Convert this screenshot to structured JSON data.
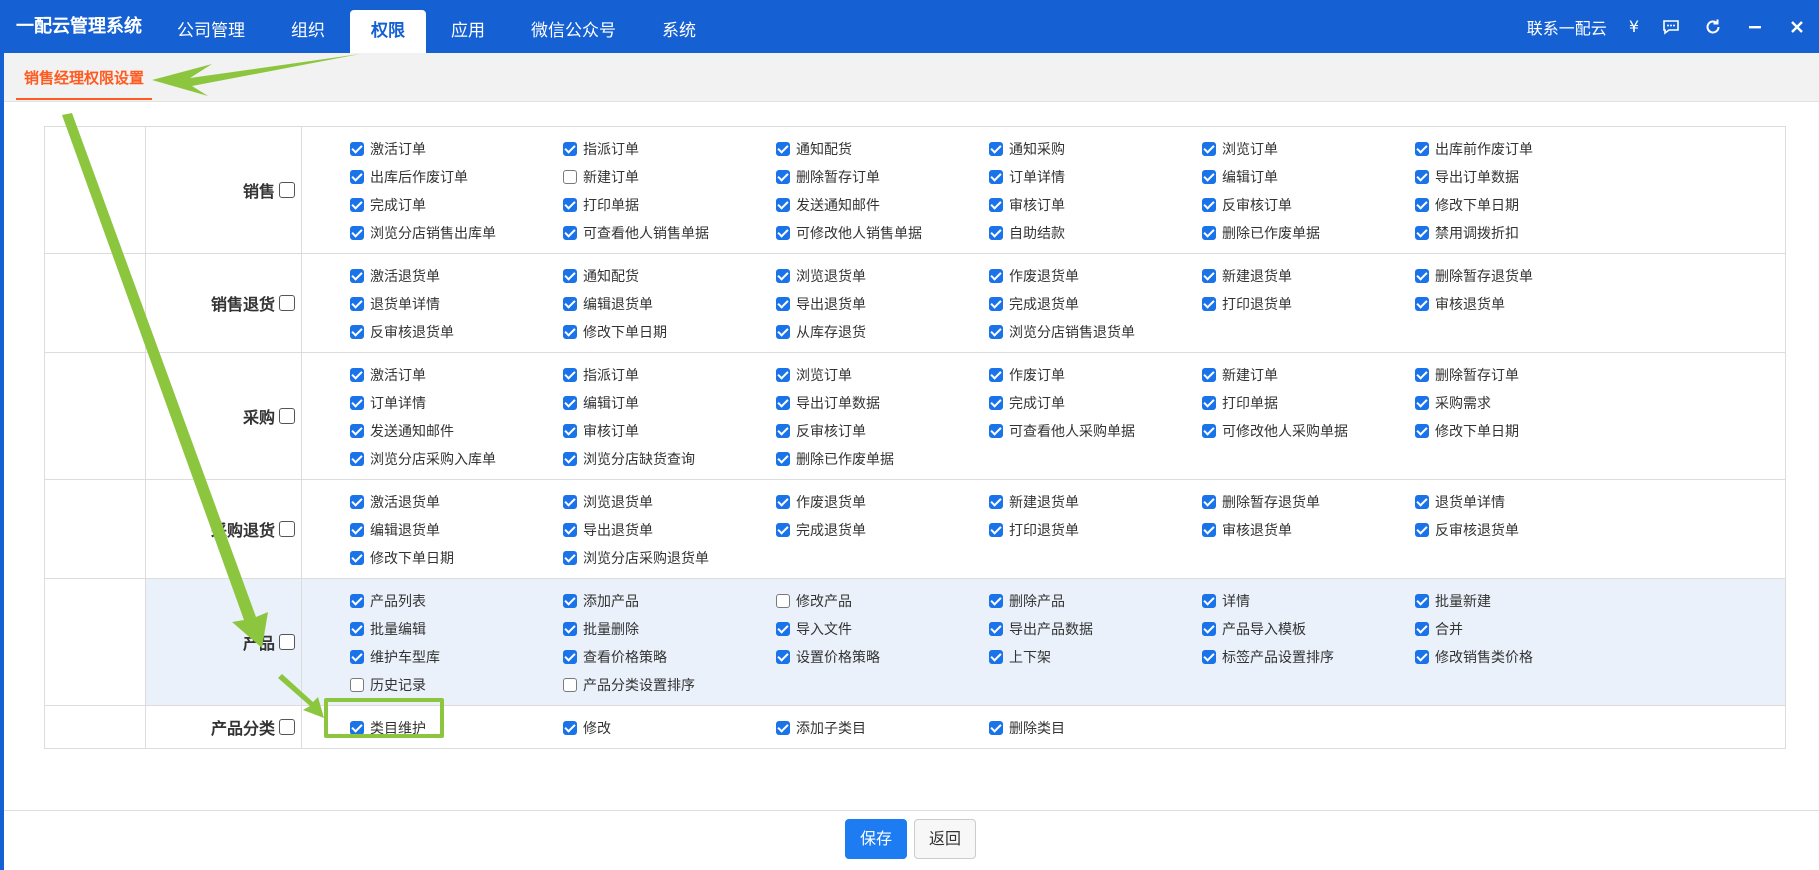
{
  "app": {
    "title": "一配云管理系统"
  },
  "nav": {
    "items": [
      {
        "label": "公司管理",
        "active": false
      },
      {
        "label": "组织",
        "active": false
      },
      {
        "label": "权限",
        "active": true
      },
      {
        "label": "应用",
        "active": false
      },
      {
        "label": "微信公众号",
        "active": false
      },
      {
        "label": "系统",
        "active": false
      }
    ]
  },
  "header_right": {
    "contact": "联系一配云",
    "currency_symbol": "¥"
  },
  "tab": {
    "active_label": "销售经理权限设置"
  },
  "groups": [
    {
      "name": "销售",
      "checked": false,
      "highlight": false,
      "items": [
        {
          "label": "激活订单",
          "checked": true
        },
        {
          "label": "指派订单",
          "checked": true
        },
        {
          "label": "通知配货",
          "checked": true
        },
        {
          "label": "通知采购",
          "checked": true
        },
        {
          "label": "浏览订单",
          "checked": true
        },
        {
          "label": "出库前作废订单",
          "checked": true
        },
        {
          "label": "出库后作废订单",
          "checked": true
        },
        {
          "label": "新建订单",
          "checked": false
        },
        {
          "label": "删除暂存订单",
          "checked": true
        },
        {
          "label": "订单详情",
          "checked": true
        },
        {
          "label": "编辑订单",
          "checked": true
        },
        {
          "label": "导出订单数据",
          "checked": true
        },
        {
          "label": "完成订单",
          "checked": true
        },
        {
          "label": "打印单据",
          "checked": true
        },
        {
          "label": "发送通知邮件",
          "checked": true
        },
        {
          "label": "审核订单",
          "checked": true
        },
        {
          "label": "反审核订单",
          "checked": true
        },
        {
          "label": "修改下单日期",
          "checked": true
        },
        {
          "label": "浏览分店销售出库单",
          "checked": true
        },
        {
          "label": "可查看他人销售单据",
          "checked": true
        },
        {
          "label": "可修改他人销售单据",
          "checked": true
        },
        {
          "label": "自助结款",
          "checked": true
        },
        {
          "label": "删除已作废单据",
          "checked": true
        },
        {
          "label": "禁用调拨折扣",
          "checked": true
        }
      ]
    },
    {
      "name": "销售退货",
      "checked": false,
      "highlight": false,
      "items": [
        {
          "label": "激活退货单",
          "checked": true
        },
        {
          "label": "通知配货",
          "checked": true
        },
        {
          "label": "浏览退货单",
          "checked": true
        },
        {
          "label": "作废退货单",
          "checked": true
        },
        {
          "label": "新建退货单",
          "checked": true
        },
        {
          "label": "删除暂存退货单",
          "checked": true
        },
        {
          "label": "退货单详情",
          "checked": true
        },
        {
          "label": "编辑退货单",
          "checked": true
        },
        {
          "label": "导出退货单",
          "checked": true
        },
        {
          "label": "完成退货单",
          "checked": true
        },
        {
          "label": "打印退货单",
          "checked": true
        },
        {
          "label": "审核退货单",
          "checked": true
        },
        {
          "label": "反审核退货单",
          "checked": true
        },
        {
          "label": "修改下单日期",
          "checked": true
        },
        {
          "label": "从库存退货",
          "checked": true
        },
        {
          "label": "浏览分店销售退货单",
          "checked": true
        }
      ]
    },
    {
      "name": "采购",
      "checked": false,
      "highlight": false,
      "items": [
        {
          "label": "激活订单",
          "checked": true
        },
        {
          "label": "指派订单",
          "checked": true
        },
        {
          "label": "浏览订单",
          "checked": true
        },
        {
          "label": "作废订单",
          "checked": true
        },
        {
          "label": "新建订单",
          "checked": true
        },
        {
          "label": "删除暂存订单",
          "checked": true
        },
        {
          "label": "订单详情",
          "checked": true
        },
        {
          "label": "编辑订单",
          "checked": true
        },
        {
          "label": "导出订单数据",
          "checked": true
        },
        {
          "label": "完成订单",
          "checked": true
        },
        {
          "label": "打印单据",
          "checked": true
        },
        {
          "label": "采购需求",
          "checked": true
        },
        {
          "label": "发送通知邮件",
          "checked": true
        },
        {
          "label": "审核订单",
          "checked": true
        },
        {
          "label": "反审核订单",
          "checked": true
        },
        {
          "label": "可查看他人采购单据",
          "checked": true
        },
        {
          "label": "可修改他人采购单据",
          "checked": true
        },
        {
          "label": "修改下单日期",
          "checked": true
        },
        {
          "label": "浏览分店采购入库单",
          "checked": true
        },
        {
          "label": "浏览分店缺货查询",
          "checked": true
        },
        {
          "label": "删除已作废单据",
          "checked": true
        }
      ]
    },
    {
      "name": "采购退货",
      "checked": false,
      "highlight": false,
      "items": [
        {
          "label": "激活退货单",
          "checked": true
        },
        {
          "label": "浏览退货单",
          "checked": true
        },
        {
          "label": "作废退货单",
          "checked": true
        },
        {
          "label": "新建退货单",
          "checked": true
        },
        {
          "label": "删除暂存退货单",
          "checked": true
        },
        {
          "label": "退货单详情",
          "checked": true
        },
        {
          "label": "编辑退货单",
          "checked": true
        },
        {
          "label": "导出退货单",
          "checked": true
        },
        {
          "label": "完成退货单",
          "checked": true
        },
        {
          "label": "打印退货单",
          "checked": true
        },
        {
          "label": "审核退货单",
          "checked": true
        },
        {
          "label": "反审核退货单",
          "checked": true
        },
        {
          "label": "修改下单日期",
          "checked": true
        },
        {
          "label": "浏览分店采购退货单",
          "checked": true
        }
      ]
    },
    {
      "name": "产品",
      "checked": false,
      "highlight": true,
      "items": [
        {
          "label": "产品列表",
          "checked": true
        },
        {
          "label": "添加产品",
          "checked": true
        },
        {
          "label": "修改产品",
          "checked": false
        },
        {
          "label": "删除产品",
          "checked": true
        },
        {
          "label": "详情",
          "checked": true
        },
        {
          "label": "批量新建",
          "checked": true
        },
        {
          "label": "批量编辑",
          "checked": true
        },
        {
          "label": "批量删除",
          "checked": true
        },
        {
          "label": "导入文件",
          "checked": true
        },
        {
          "label": "导出产品数据",
          "checked": true
        },
        {
          "label": "产品导入模板",
          "checked": true
        },
        {
          "label": "合并",
          "checked": true
        },
        {
          "label": "维护车型库",
          "checked": true
        },
        {
          "label": "查看价格策略",
          "checked": true
        },
        {
          "label": "设置价格策略",
          "checked": true
        },
        {
          "label": "上下架",
          "checked": true
        },
        {
          "label": "标签产品设置排序",
          "checked": true
        },
        {
          "label": "修改销售类价格",
          "checked": true
        },
        {
          "label": "历史记录",
          "checked": false
        },
        {
          "label": "产品分类设置排序",
          "checked": false
        }
      ]
    },
    {
      "name": "产品分类",
      "checked": false,
      "highlight": false,
      "items": [
        {
          "label": "类目维护",
          "checked": true
        },
        {
          "label": "修改",
          "checked": true
        },
        {
          "label": "添加子类目",
          "checked": true
        },
        {
          "label": "删除类目",
          "checked": true
        }
      ]
    }
  ],
  "footer": {
    "save_label": "保存",
    "back_label": "返回"
  },
  "colors": {
    "primary": "#1560d3",
    "accent": "#ff5a1f",
    "annotation": "#8cc63f"
  }
}
